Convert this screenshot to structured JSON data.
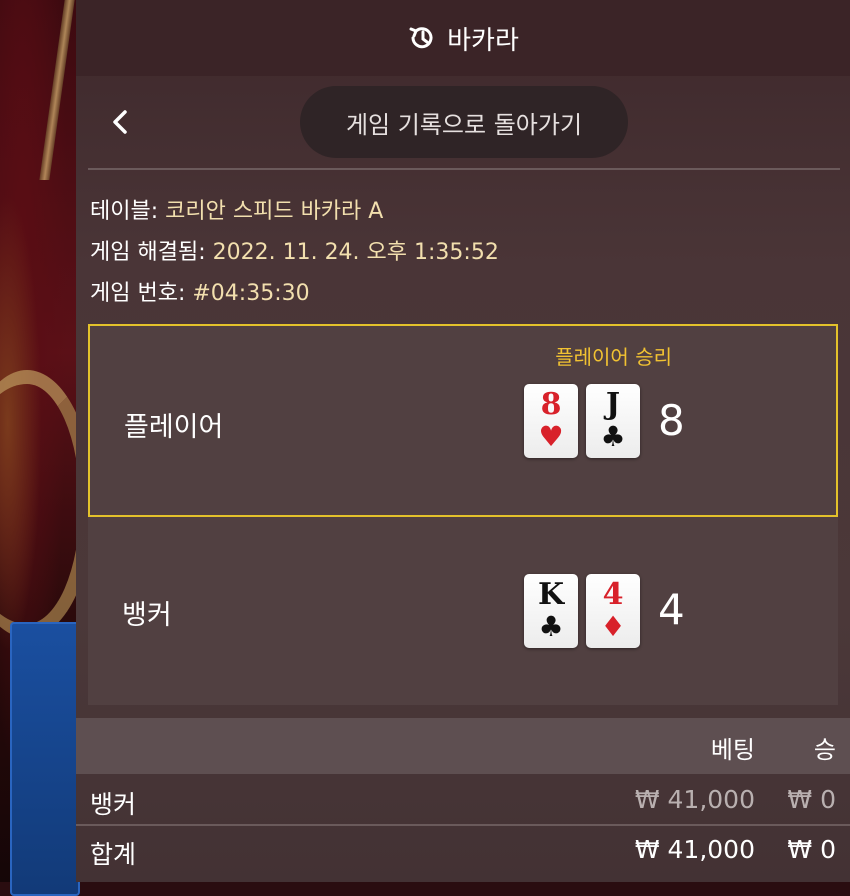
{
  "header": {
    "title": "바카라",
    "icon": "history-icon"
  },
  "back": {
    "label": "게임 기록으로 돌아가기",
    "icon": "chevron-left-icon"
  },
  "info": {
    "table_label": "테이블:",
    "table_value": "코리안 스피드 바카라 A",
    "resolved_label": "게임 해결됨:",
    "resolved_value": "2022. 11. 24. 오후 1:35:52",
    "number_label": "게임 번호:",
    "number_value": "#04:35:30"
  },
  "player": {
    "name": "플레이어",
    "result": "플레이어 승리",
    "score": "8",
    "cards": [
      {
        "rank": "8",
        "suit": "♥",
        "suit_name": "heart",
        "color": "#d8212a"
      },
      {
        "rank": "J",
        "suit": "♣",
        "suit_name": "club",
        "color": "#111111"
      }
    ]
  },
  "banker": {
    "name": "뱅커",
    "score": "4",
    "cards": [
      {
        "rank": "K",
        "suit": "♣",
        "suit_name": "club",
        "color": "#111111"
      },
      {
        "rank": "4",
        "suit": "♦",
        "suit_name": "diamond",
        "color": "#d8212a"
      }
    ]
  },
  "bets": {
    "headers": {
      "bet": "베팅",
      "win": "승"
    },
    "rows": [
      {
        "label": "뱅커",
        "bet": "₩ 41,000",
        "win": "₩ 0"
      }
    ],
    "total": {
      "label": "합계",
      "bet": "₩ 41,000",
      "win": "₩ 0"
    }
  },
  "colors": {
    "winner_border": "#e3c22b",
    "value_text": "#f2dfae",
    "result_text": "#f1c232"
  }
}
